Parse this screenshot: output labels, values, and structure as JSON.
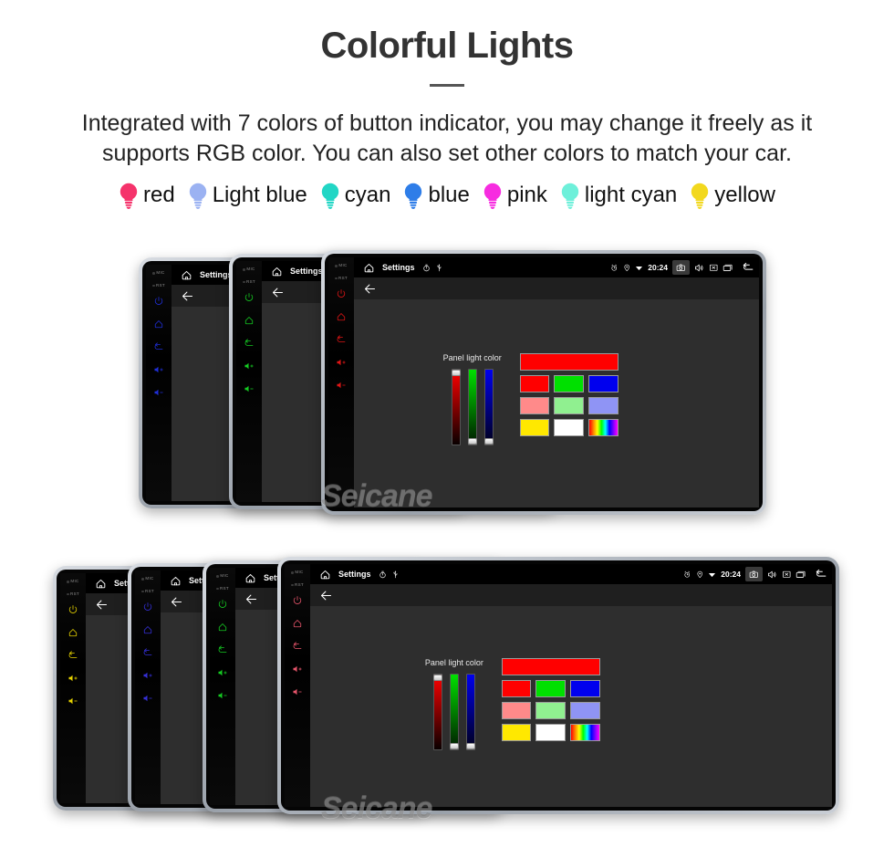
{
  "header": {
    "title": "Colorful Lights",
    "description": "Integrated with 7 colors of button indicator, you may change it freely as it supports RGB color. You can also set other colors to match your car."
  },
  "legend": {
    "items": [
      {
        "label": "red",
        "color": "#f5336b",
        "icon": "bulb-icon"
      },
      {
        "label": "Light blue",
        "color": "#9bb2f2",
        "icon": "bulb-icon"
      },
      {
        "label": "cyan",
        "color": "#22d6c5",
        "icon": "bulb-icon"
      },
      {
        "label": "blue",
        "color": "#2e7de8",
        "icon": "bulb-icon"
      },
      {
        "label": "pink",
        "color": "#f72ce0",
        "icon": "bulb-icon"
      },
      {
        "label": "light cyan",
        "color": "#6ef0da",
        "icon": "bulb-icon"
      },
      {
        "label": "yellow",
        "color": "#f2d81e",
        "icon": "bulb-icon"
      }
    ]
  },
  "device_ui": {
    "rail": {
      "mic_label": "MIC",
      "rst_label": "RST",
      "buttons": [
        "power-icon",
        "home-icon",
        "back-icon",
        "volume-up-icon",
        "volume-down-icon"
      ]
    },
    "statusbar": {
      "home_icon": "home-icon",
      "title": "Settings",
      "timer_icon": "timer-icon",
      "usb_icon": "usb-icon",
      "alarm_icon": "alarm-icon",
      "location_icon": "location-pin-icon",
      "signal_icon": "signal-icon",
      "clock": "20:24",
      "camera_icon": "camera-icon",
      "volume_icon": "speaker-icon",
      "mute_icon": "mute-box-icon",
      "recents_icon": "recents-icon",
      "back_icon": "back-arrow-icon"
    },
    "appbar": {
      "back_icon": "back-arrow-icon"
    },
    "picker": {
      "label": "Panel light color",
      "sliders": [
        {
          "name": "red-slider",
          "thumb_position": "top"
        },
        {
          "name": "green-slider",
          "thumb_position": "bottom"
        },
        {
          "name": "blue-slider",
          "thumb_position": "bottom"
        }
      ],
      "preview_color": "#ff0000",
      "swatch_rows": [
        [
          "#ff0000",
          "#00e000",
          "#0000ee"
        ],
        [
          "#ff8a8a",
          "#90f090",
          "#8f94f5"
        ],
        [
          "#ffe800",
          "#ffffff",
          "rainbow"
        ]
      ]
    }
  },
  "clusters": {
    "top": {
      "devices": [
        {
          "name": "device-top-1",
          "rail_color": "#1f2fd8",
          "show_full_ui": false
        },
        {
          "name": "device-top-2",
          "rail_color": "#15cc22",
          "show_full_ui": false
        },
        {
          "name": "device-top-3",
          "rail_color": "#e01515",
          "show_full_ui": true
        }
      ],
      "watermark": "Seicane"
    },
    "bottom": {
      "devices": [
        {
          "name": "device-bottom-1",
          "rail_color": "#e8d400",
          "show_full_ui": false
        },
        {
          "name": "device-bottom-2",
          "rail_color": "#3530d8",
          "show_full_ui": false
        },
        {
          "name": "device-bottom-3",
          "rail_color": "#15cc22",
          "show_full_ui": false
        },
        {
          "name": "device-bottom-4",
          "rail_color": "#e8556b",
          "show_full_ui": true
        }
      ],
      "watermark": "Seicane"
    }
  }
}
